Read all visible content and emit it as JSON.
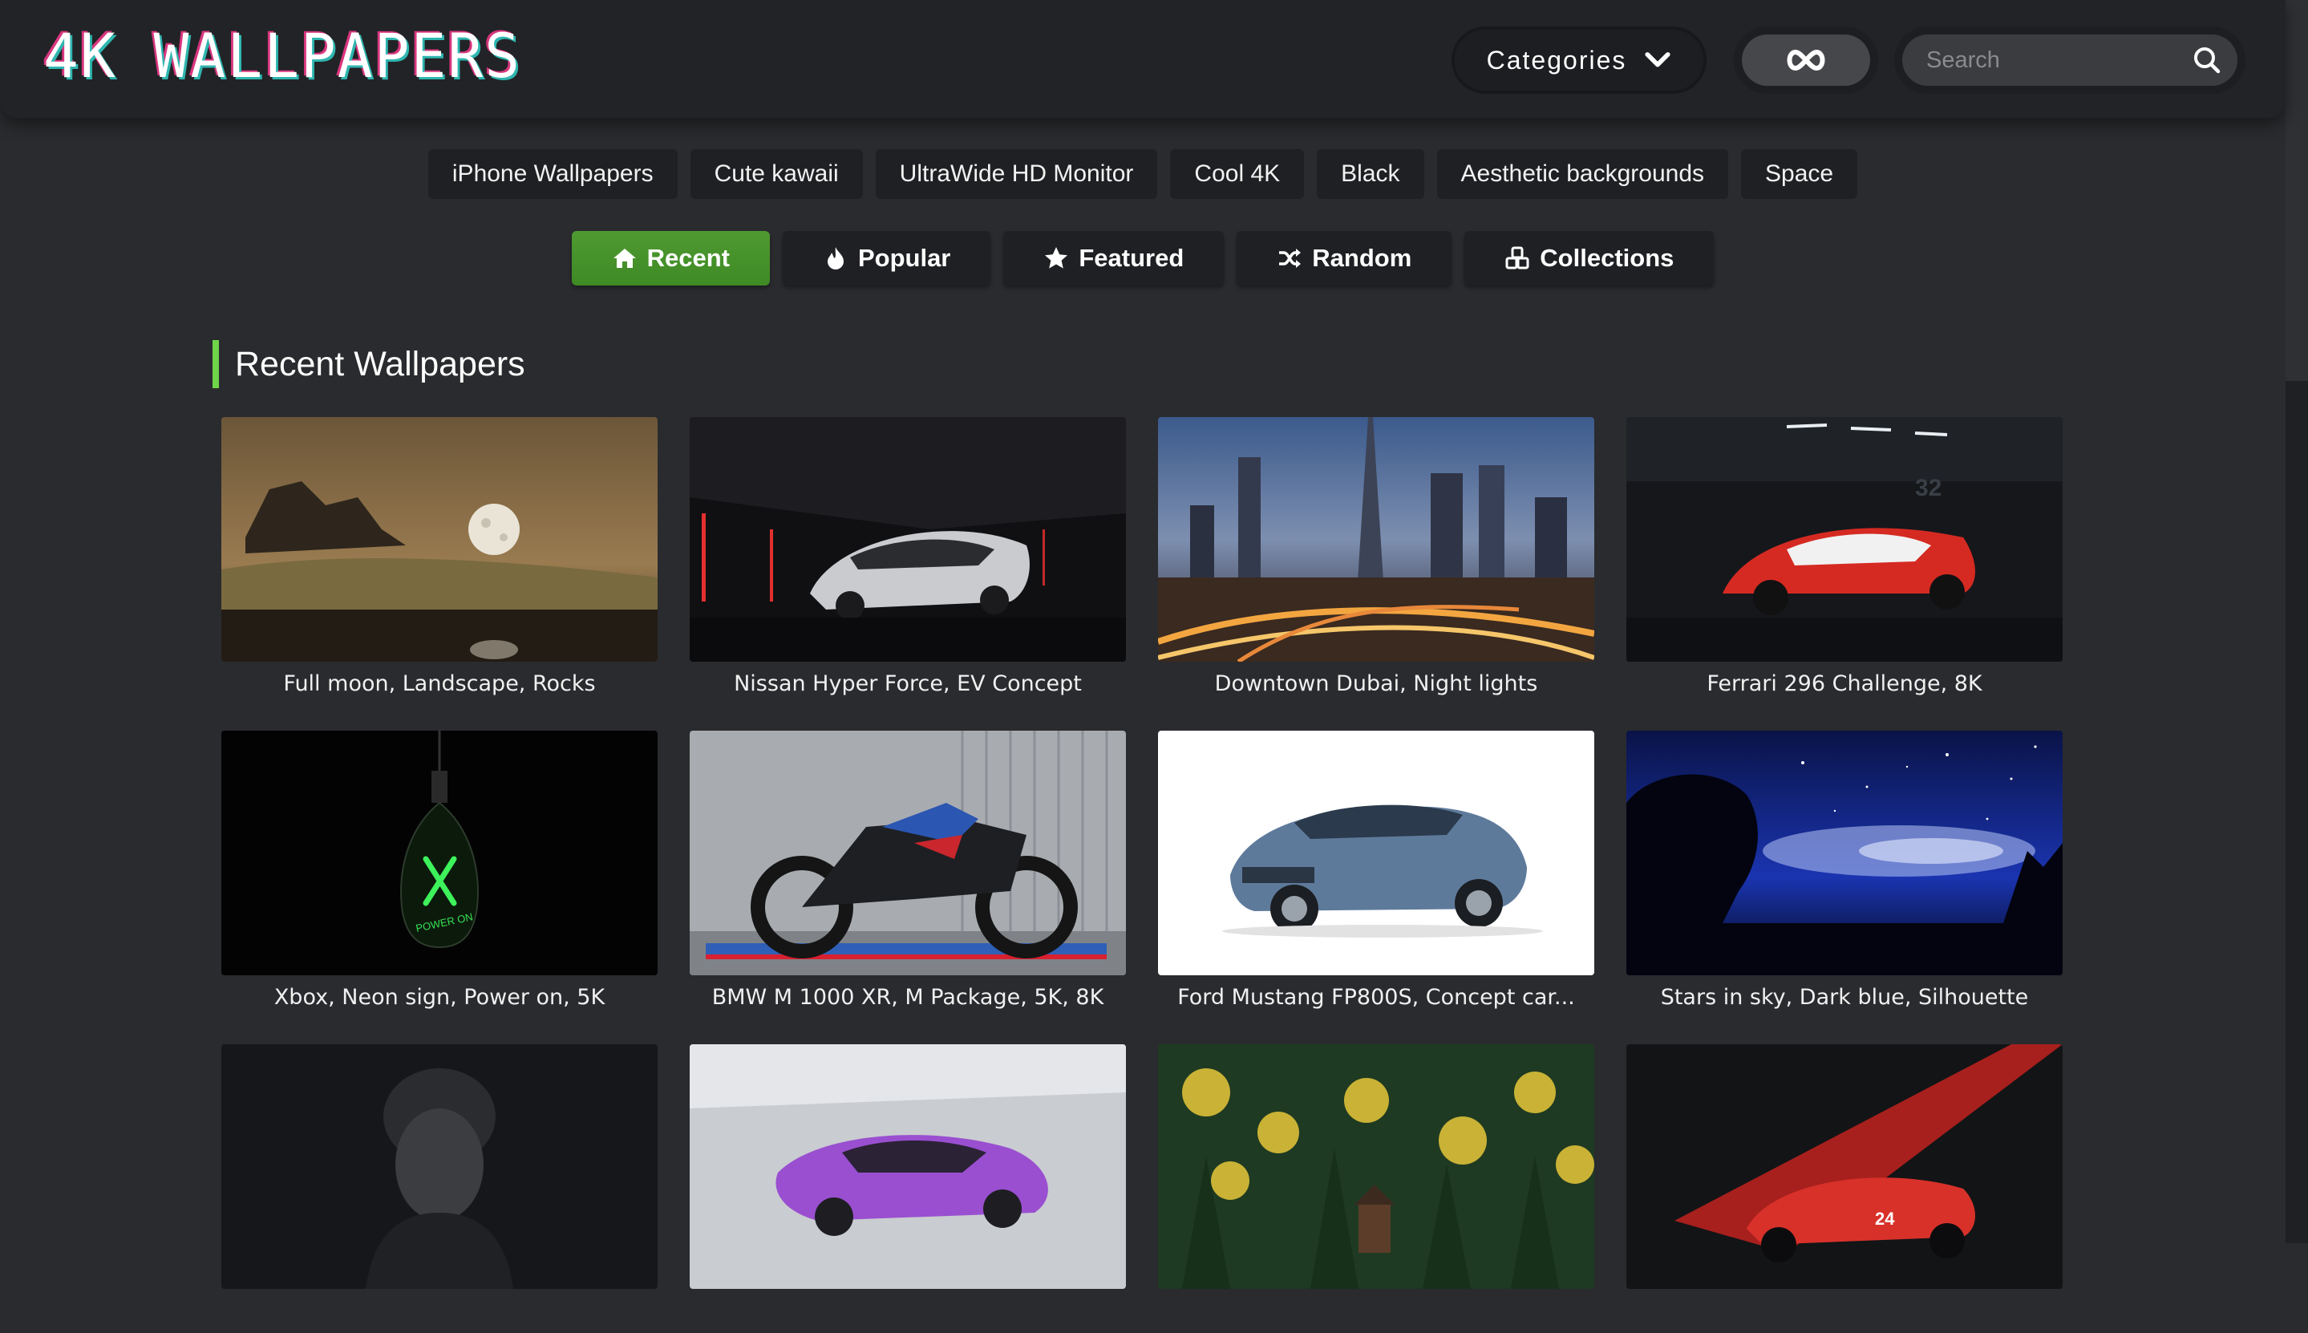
{
  "header": {
    "logo": "4K WALLPAPERS",
    "categories_label": "Categories",
    "infinite_icon": "infinity-icon",
    "search": {
      "placeholder": "Search"
    }
  },
  "tags": [
    "iPhone Wallpapers",
    "Cute kawaii",
    "UltraWide HD Monitor",
    "Cool 4K",
    "Black",
    "Aesthetic backgrounds",
    "Space"
  ],
  "tabs": [
    {
      "label": "Recent",
      "icon": "home-icon",
      "active": true
    },
    {
      "label": "Popular",
      "icon": "fire-icon",
      "active": false
    },
    {
      "label": "Featured",
      "icon": "star-icon",
      "active": false
    },
    {
      "label": "Random",
      "icon": "shuffle-icon",
      "active": false
    },
    {
      "label": "Collections",
      "icon": "cubes-icon",
      "active": false
    }
  ],
  "section": {
    "title": "Recent Wallpapers"
  },
  "wallpapers": [
    {
      "caption": "Full moon, Landscape, Rocks"
    },
    {
      "caption": "Nissan Hyper Force, EV Concept"
    },
    {
      "caption": "Downtown Dubai, Night lights"
    },
    {
      "caption": "Ferrari 296 Challenge, 8K"
    },
    {
      "caption": "Xbox, Neon sign, Power on, 5K"
    },
    {
      "caption": "BMW M 1000 XR, M Package, 5K, 8K"
    },
    {
      "caption": "Ford Mustang FP800S, Concept car..."
    },
    {
      "caption": "Stars in sky, Dark blue, Silhouette"
    },
    {
      "caption": ""
    },
    {
      "caption": ""
    },
    {
      "caption": ""
    },
    {
      "caption": ""
    }
  ],
  "thumb_texts": {
    "xbox_sign": "POWER ON",
    "ferrari_number": "32",
    "racecar_number": "24"
  },
  "colors": {
    "active_tab": "#4a9630",
    "heading_accent": "#6ed44a",
    "background": "#2a2b2e",
    "header": "#222326"
  }
}
